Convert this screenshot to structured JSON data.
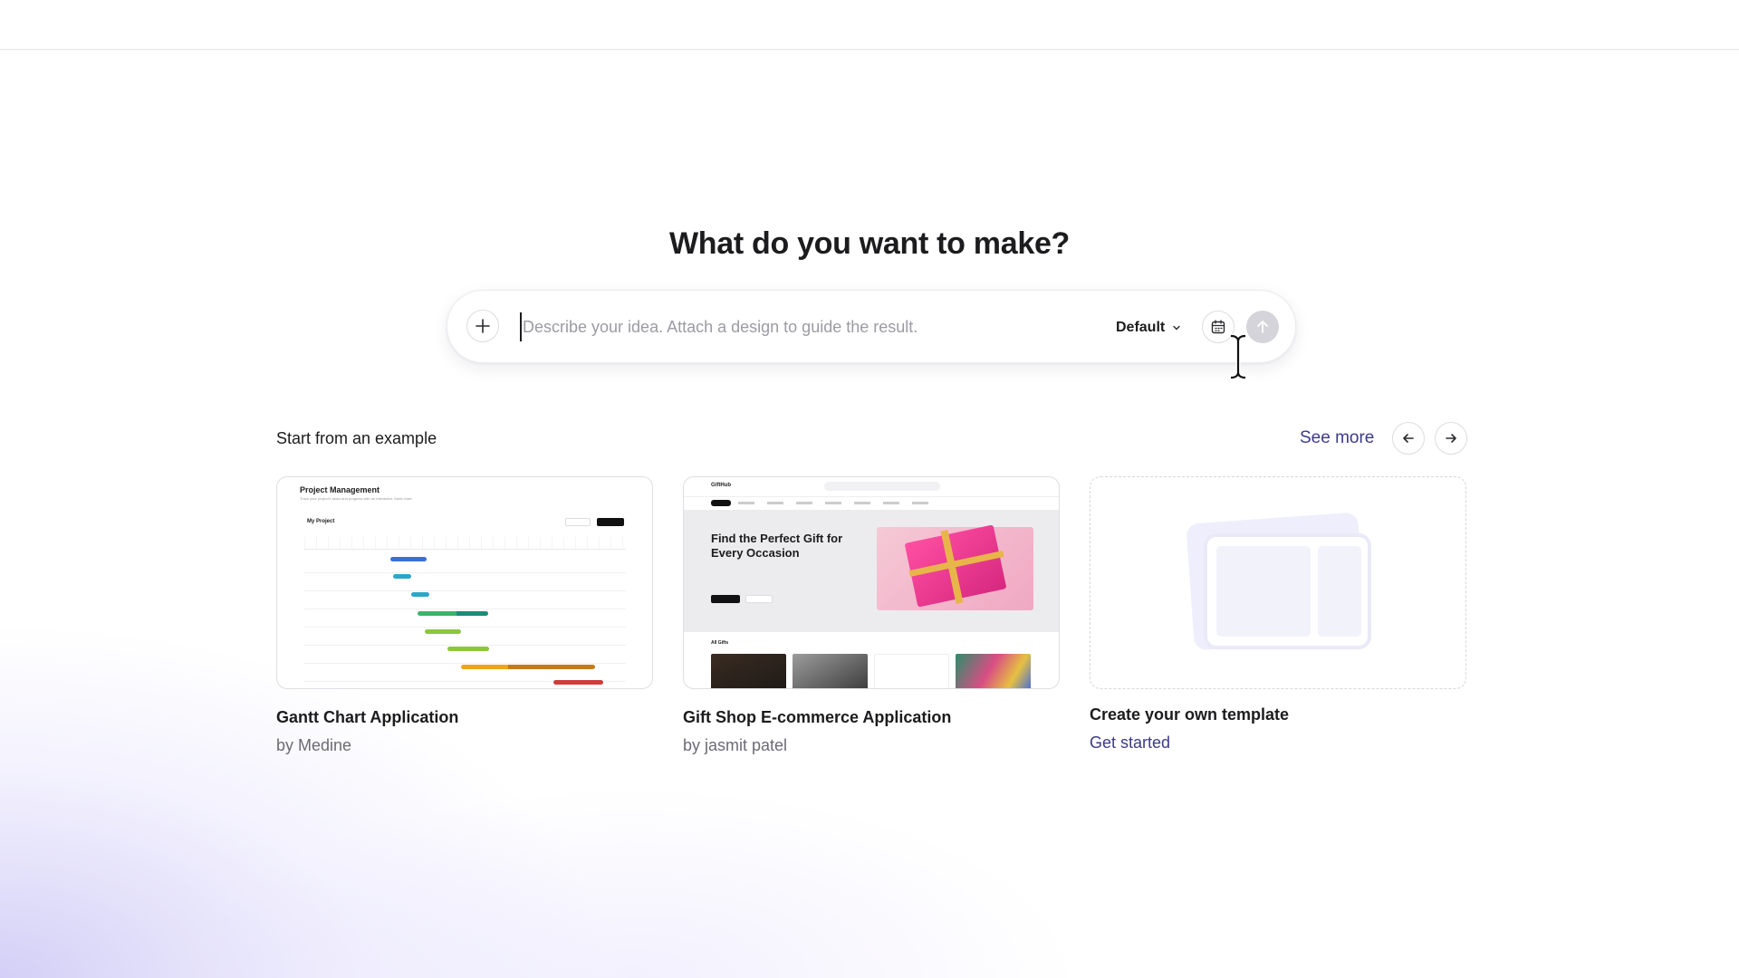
{
  "headline": "What do you want to make?",
  "prompt": {
    "placeholder": "Describe your idea. Attach a design to guide the result.",
    "value": "",
    "model": "Default",
    "add_icon": "plus-icon",
    "calendar_icon": "calendar-icon",
    "send_icon": "arrow-up-icon",
    "model_caret_icon": "chevron-down-icon"
  },
  "examples": {
    "title": "Start from an example",
    "see_more": "See more",
    "prev_icon": "arrow-left-icon",
    "next_icon": "arrow-right-icon",
    "cards": [
      {
        "title": "Gantt Chart Application",
        "author": "by Medine",
        "thumb": {
          "heading": "Project Management",
          "subheading": "Track your project's tasks and progress with an interactive Gantt chart.",
          "project": "My Project"
        }
      },
      {
        "title": "Gift Shop E-commerce Application",
        "author": "by jasmit patel",
        "thumb": {
          "brand": "GiftHub",
          "hero": "Find the Perfect Gift for Every Occasion",
          "section": "All Gifts"
        }
      },
      {
        "title": "Create your own template",
        "action": "Get started"
      }
    ]
  },
  "colors": {
    "accent_link": "#3c3a8a",
    "glow": "#b0a8f0",
    "send_disabled": "#d4d4da"
  }
}
